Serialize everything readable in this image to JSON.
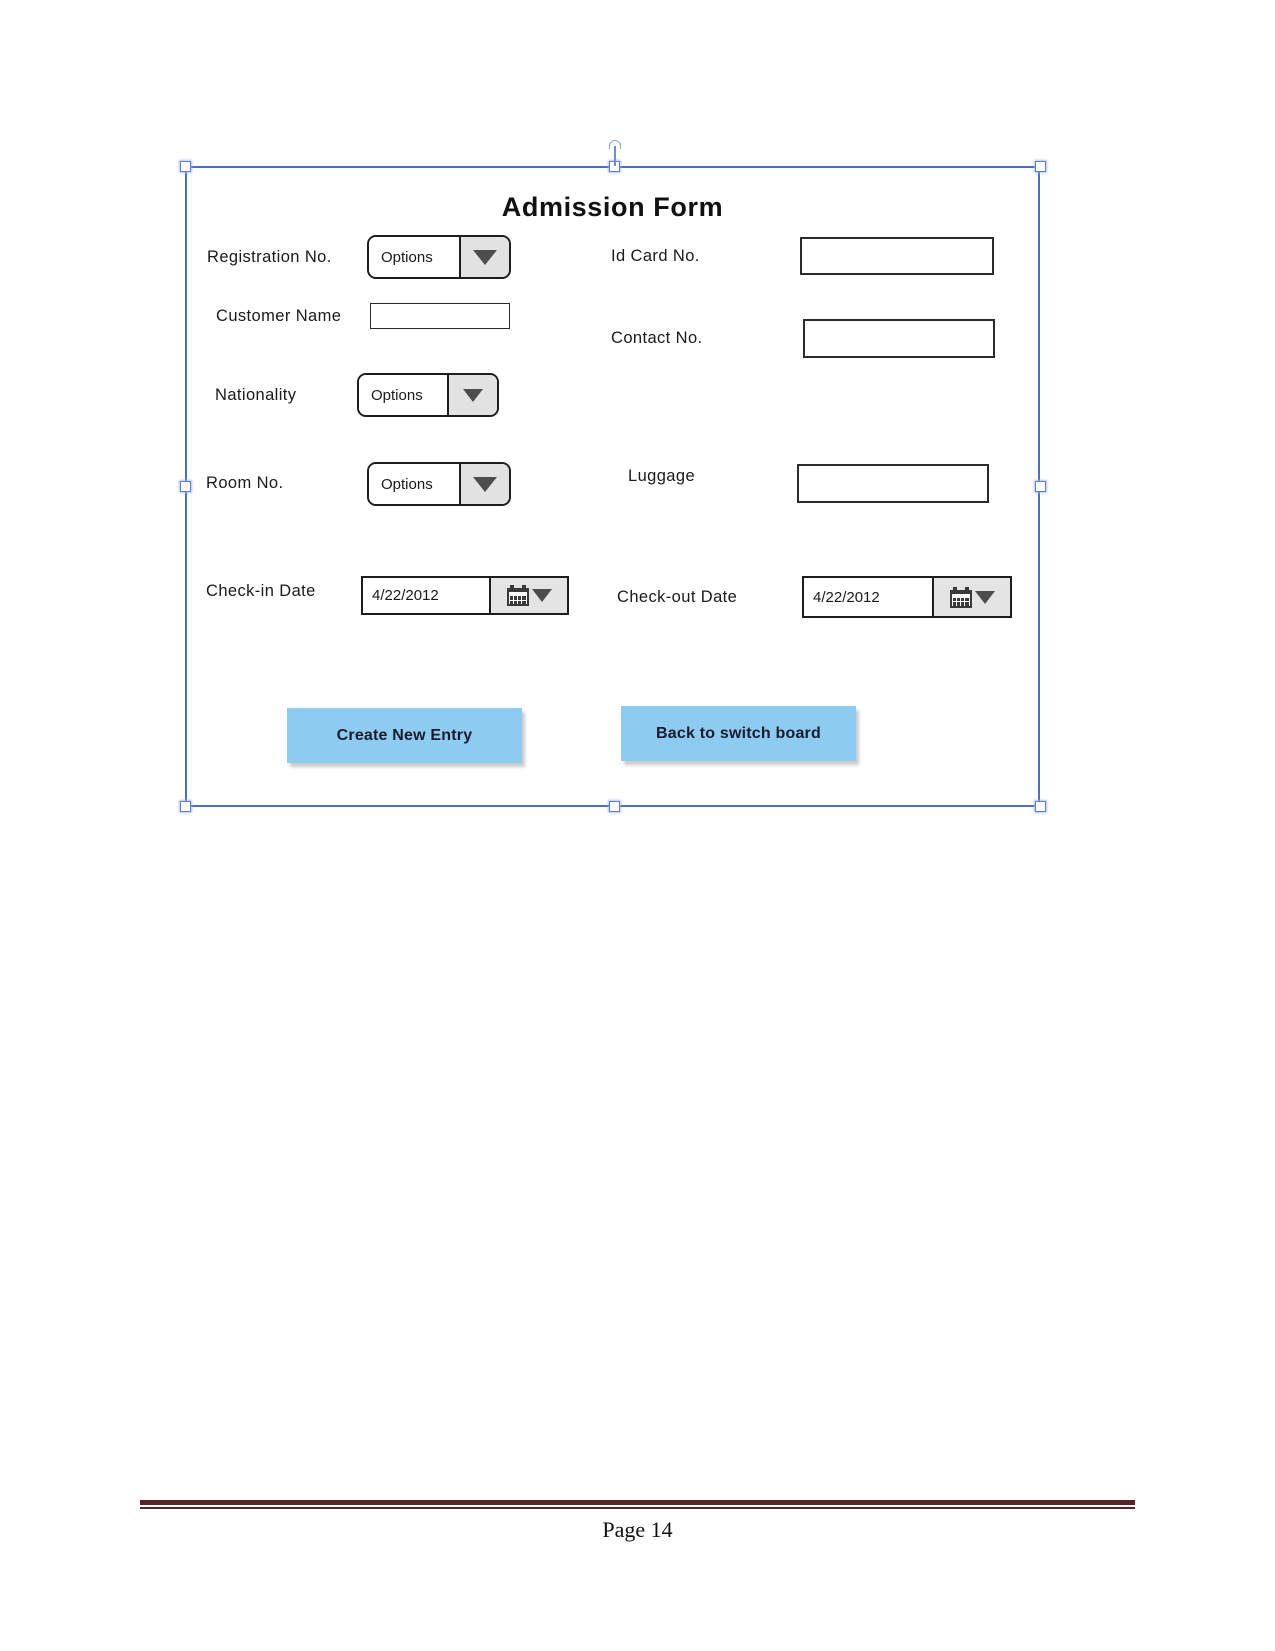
{
  "document": {
    "footer": {
      "page_label": "Page 14",
      "rule_color": "#5C2327"
    }
  },
  "form": {
    "title": "Admission Form",
    "selected": true,
    "accent_button_color": "#8ECBF0",
    "selection_color": "#4A6FC0",
    "fields": {
      "registration_no": {
        "label": "Registration No.",
        "type": "combobox",
        "value": "Options"
      },
      "customer_name": {
        "label": "Customer Name",
        "type": "textbox",
        "value": ""
      },
      "nationality": {
        "label": "Nationality",
        "type": "combobox",
        "value": "Options"
      },
      "room_no": {
        "label": "Room  No.",
        "type": "combobox",
        "value": "Options"
      },
      "check_in_date": {
        "label": "Check-in Date",
        "type": "datepicker",
        "value": "4/22/2012"
      },
      "id_card_no": {
        "label": "Id Card No.",
        "type": "textbox",
        "value": ""
      },
      "contact_no": {
        "label": "Contact No.",
        "type": "textbox",
        "value": ""
      },
      "luggage": {
        "label": "Luggage",
        "type": "textbox",
        "value": ""
      },
      "check_out_date": {
        "label": "Check-out Date",
        "type": "datepicker",
        "value": "4/22/2012"
      }
    },
    "buttons": {
      "create_new_entry": "Create New Entry",
      "back_to_switch_board": "Back to switch board"
    }
  }
}
